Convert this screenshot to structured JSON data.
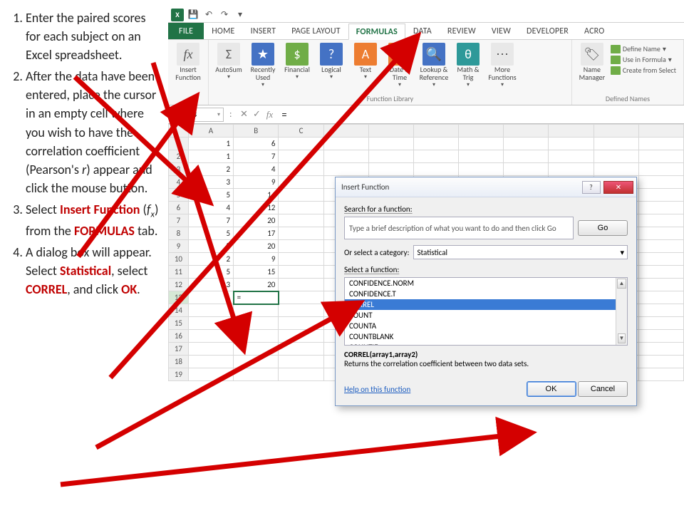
{
  "instructions": {
    "step1": "Enter the paired scores for each subject on an Excel spreadsheet.",
    "step2_a": "After the data have been entered, place the cursor in an empty cell where you wish to have the correlation coefficient (Pearson's ",
    "step2_r": "r",
    "step2_b": ") appear and click the mouse button.",
    "step3_a": "Select ",
    "step3_insert": "Insert Function",
    "step3_b": " (",
    "step3_fx_f": "f",
    "step3_fx_x": "x",
    "step3_c": ") from the ",
    "step3_formulas": "FORMULAS",
    "step3_d": " tab.",
    "step4_a": "A dialog box will appear. Select ",
    "step4_stat": "Statistical",
    "step4_b": ", select ",
    "step4_correl": "CORREL",
    "step4_c": ", and click ",
    "step4_ok": "OK",
    "step4_d": "."
  },
  "qat": {
    "logo": "X",
    "save": "💾",
    "undo": "↶",
    "redo": "↷",
    "dd": "▾"
  },
  "tabs": {
    "file": "FILE",
    "home": "HOME",
    "insert": "INSERT",
    "page_layout": "PAGE LAYOUT",
    "formulas": "FORMULAS",
    "data": "DATA",
    "review": "REVIEW",
    "view": "VIEW",
    "developer": "DEVELOPER",
    "acro": "Acro"
  },
  "ribbon": {
    "insert_fn": "Insert Function",
    "autosum": "AutoSum",
    "recent": "Recently Used",
    "financial": "Financial",
    "logical": "Logical",
    "text": "Text",
    "datetime": "Date & Time",
    "lookup": "Lookup & Reference",
    "math": "Math & Trig",
    "more": "More Functions",
    "library_label": "Function Library",
    "name_mgr": "Name Manager",
    "define_name": "Define Name",
    "use_formula": "Use in Formula",
    "create_sel": "Create from Select",
    "names_label": "Defined Names",
    "dd": "▾"
  },
  "formula_bar": {
    "name_box": "B13",
    "fx": "fx",
    "value": "=",
    "x": "✕",
    "check": "✓"
  },
  "grid": {
    "cols": [
      "A",
      "B",
      "C"
    ],
    "rows": [
      {
        "n": "1",
        "a": "1",
        "b": "6"
      },
      {
        "n": "2",
        "a": "1",
        "b": "7"
      },
      {
        "n": "3",
        "a": "2",
        "b": "4"
      },
      {
        "n": "4",
        "a": "3",
        "b": "9"
      },
      {
        "n": "5",
        "a": "5",
        "b": "14"
      },
      {
        "n": "6",
        "a": "4",
        "b": "12"
      },
      {
        "n": "7",
        "a": "7",
        "b": "20"
      },
      {
        "n": "8",
        "a": "5",
        "b": "17"
      },
      {
        "n": "9",
        "a": "8",
        "b": "20"
      },
      {
        "n": "10",
        "a": "2",
        "b": "9"
      },
      {
        "n": "11",
        "a": "5",
        "b": "15"
      },
      {
        "n": "12",
        "a": "3",
        "b": "20"
      },
      {
        "n": "13",
        "a": "",
        "b": "="
      },
      {
        "n": "14",
        "a": "",
        "b": ""
      },
      {
        "n": "15",
        "a": "",
        "b": ""
      },
      {
        "n": "16",
        "a": "",
        "b": ""
      },
      {
        "n": "17",
        "a": "",
        "b": ""
      },
      {
        "n": "18",
        "a": "",
        "b": ""
      },
      {
        "n": "19",
        "a": "",
        "b": ""
      }
    ]
  },
  "dialog": {
    "title": "Insert Function",
    "help_q": "?",
    "close_x": "✕",
    "search_label": "Search for a function:",
    "search_placeholder": "Type a brief description of what you want to do and then click Go",
    "go": "Go",
    "category_label": "Or select a category:",
    "category_value": "Statistical",
    "select_fn_label": "Select a function:",
    "list": [
      "CONFIDENCE.NORM",
      "CONFIDENCE.T",
      "CORREL",
      "COUNT",
      "COUNTA",
      "COUNTBLANK",
      "COUNTIF"
    ],
    "sel_index": 2,
    "signature": "CORREL(array1,array2)",
    "description": "Returns the correlation coefficient between two data sets.",
    "help_link": "Help on this function",
    "ok": "OK",
    "cancel": "Cancel",
    "up": "▲",
    "down": "▼",
    "dd": "▾"
  }
}
